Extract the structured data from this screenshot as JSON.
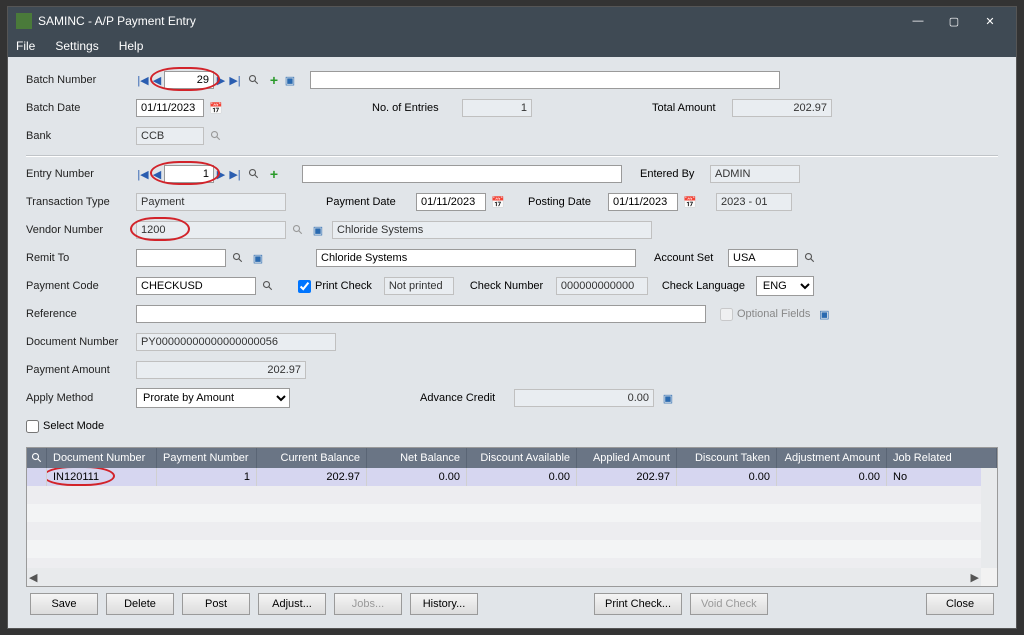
{
  "title": "SAMINC - A/P Payment Entry",
  "menu": {
    "file": "File",
    "settings": "Settings",
    "help": "Help"
  },
  "labels": {
    "batch_number": "Batch Number",
    "batch_date": "Batch Date",
    "bank": "Bank",
    "no_of_entries": "No. of Entries",
    "total_amount": "Total Amount",
    "entry_number": "Entry Number",
    "entered_by": "Entered By",
    "transaction_type": "Transaction Type",
    "payment_date": "Payment Date",
    "posting_date": "Posting Date",
    "vendor_number": "Vendor Number",
    "remit_to": "Remit To",
    "account_set": "Account Set",
    "payment_code": "Payment Code",
    "print_check": "Print Check",
    "check_number": "Check Number",
    "check_language": "Check Language",
    "reference": "Reference",
    "optional_fields": "Optional Fields",
    "document_number": "Document Number",
    "payment_amount": "Payment Amount",
    "apply_method": "Apply Method",
    "advance_credit": "Advance Credit",
    "select_mode": "Select Mode"
  },
  "values": {
    "batch_number": "29",
    "batch_desc": "",
    "batch_date": "01/11/2023",
    "bank": "CCB",
    "no_of_entries": "1",
    "total_amount": "202.97",
    "entry_number": "1",
    "entry_desc": "",
    "entered_by": "ADMIN",
    "transaction_type": "Payment",
    "payment_date": "01/11/2023",
    "posting_date": "01/11/2023",
    "period": "2023 - 01",
    "vendor_number": "1200",
    "vendor_name": "Chloride Systems",
    "remit_to": "",
    "remit_to_name": "Chloride Systems",
    "account_set": "USA",
    "payment_code": "CHECKUSD",
    "print_check_status": "Not printed",
    "check_number": "000000000000",
    "check_language": "ENG",
    "reference": "",
    "document_number": "PY00000000000000000056",
    "payment_amount": "202.97",
    "apply_method": "Prorate by Amount",
    "advance_credit": "0.00"
  },
  "grid": {
    "headers": {
      "doc": "Document Number",
      "pay_num": "Payment Number",
      "cur_bal": "Current Balance",
      "net_bal": "Net Balance",
      "disc_avail": "Discount Available",
      "applied": "Applied Amount",
      "disc_taken": "Discount Taken",
      "adj": "Adjustment Amount",
      "job": "Job Related"
    },
    "rows": [
      {
        "doc": "IN120111",
        "pay_num": "1",
        "cur_bal": "202.97",
        "net_bal": "0.00",
        "disc_avail": "0.00",
        "applied": "202.97",
        "disc_taken": "0.00",
        "adj": "0.00",
        "job": "No"
      }
    ]
  },
  "buttons": {
    "save": "Save",
    "delete": "Delete",
    "post": "Post",
    "adjust": "Adjust...",
    "jobs": "Jobs...",
    "history": "History...",
    "print_check": "Print Check...",
    "void_check": "Void Check",
    "close": "Close"
  }
}
